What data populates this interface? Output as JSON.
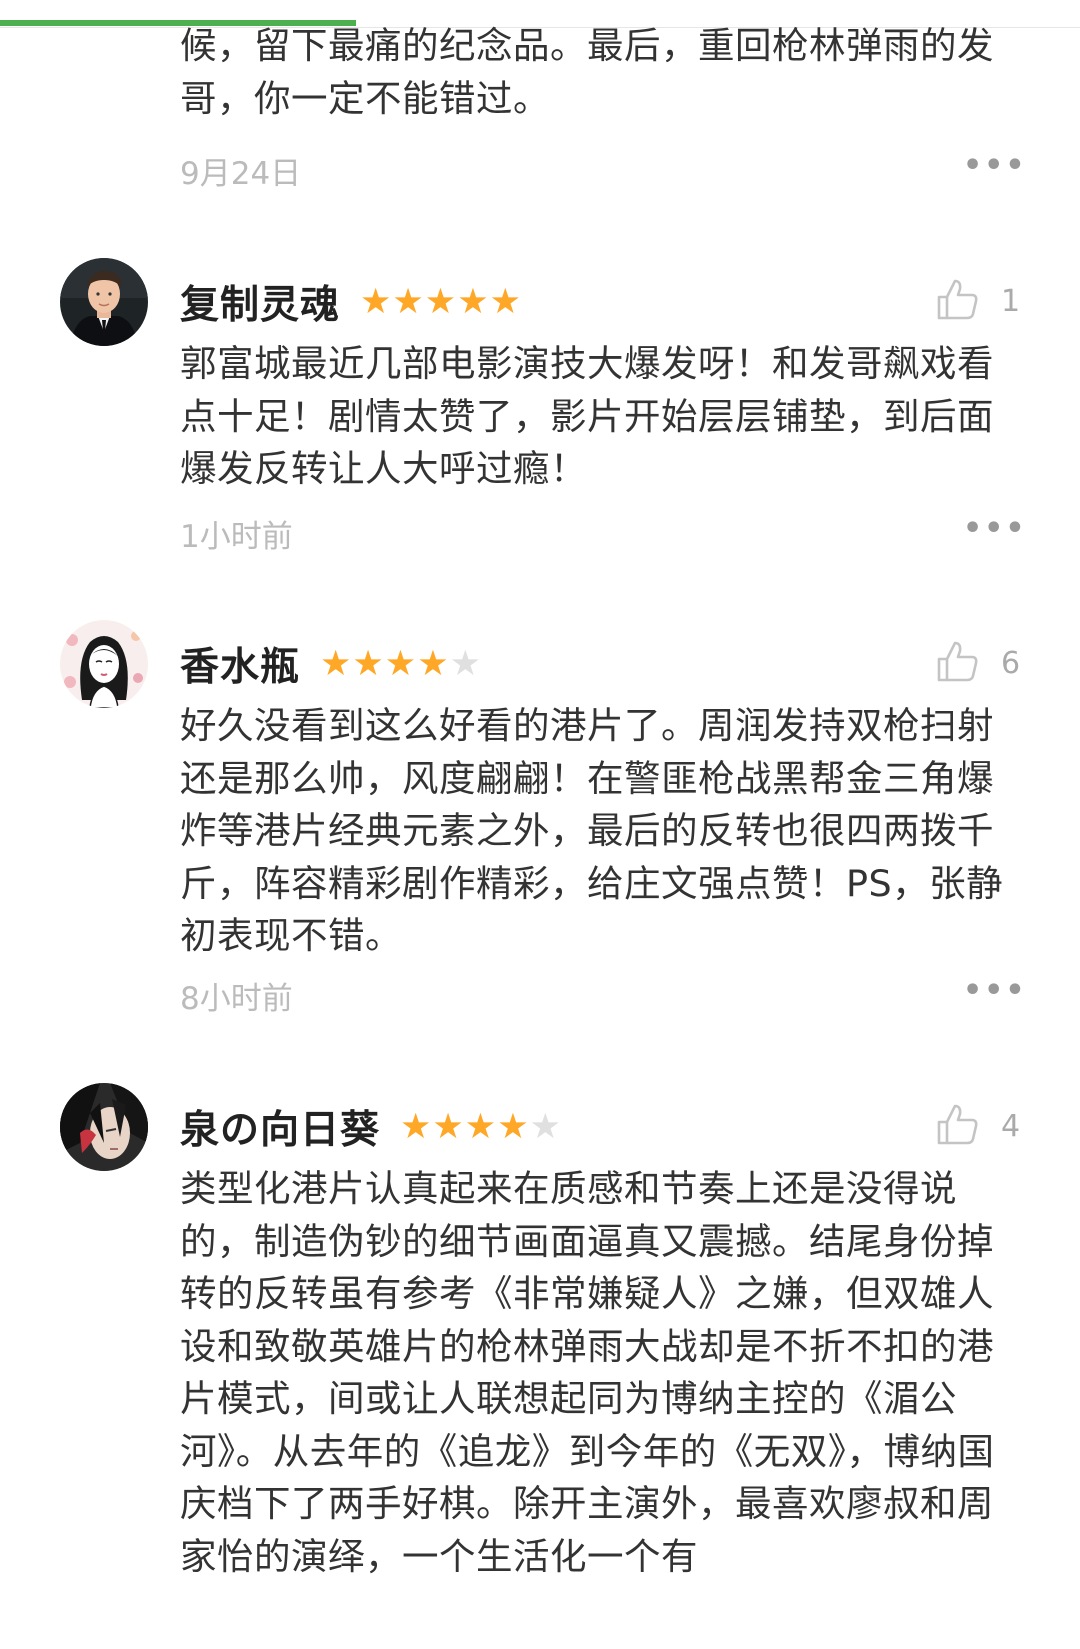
{
  "progress": {
    "fraction": 0.33,
    "color": "#4caf50"
  },
  "top_partial": {
    "text": "候，留下最痛的纪念品。最后，重回枪林弹雨的发哥，你一定不能错过。",
    "time": "9月24日"
  },
  "reviews": [
    {
      "username": "复制灵魂",
      "rating": 5,
      "max_rating": 5,
      "likes": "1",
      "text": "郭富城最近几部电影演技大爆发呀！和发哥飙戏看点十足！剧情太赞了，影片开始层层铺垫，到后面爆发反转让人大呼过瘾！",
      "time": "1小时前",
      "avatar_icon": "male-portrait-avatar"
    },
    {
      "username": "香水瓶",
      "rating": 4,
      "max_rating": 5,
      "likes": "6",
      "text": "好久没看到这么好看的港片了。周润发持双枪扫射还是那么帅，风度翩翩！在警匪枪战黑帮金三角爆炸等港片经典元素之外，最后的反转也很四两拨千斤，阵容精彩剧作精彩，给庄文强点赞！PS，张静初表现不错。",
      "time": "8小时前",
      "avatar_icon": "illustrated-girl-avatar"
    },
    {
      "username": "泉の向日葵",
      "rating": 4,
      "max_rating": 5,
      "likes": "4",
      "text": "类型化港片认真起来在质感和节奏上还是没得说的，制造伪钞的细节画面逼真又震撼。结尾身份掉转的反转虽有参考《非常嫌疑人》之嫌，但双雄人设和致敬英雄片的枪林弹雨大战却是不折不扣的港片模式，间或让人联想起同为博纳主控的《湄公河》。从去年的《追龙》到今年的《无双》，博纳国庆档下了两手好棋。除开主演外，最喜欢廖叔和周家怡的演绎，一个生活化一个有",
      "avatar_icon": "anime-character-avatar"
    }
  ],
  "icons": {
    "like": "thumbs-up-icon",
    "more": "more-options-icon",
    "star": "star-icon"
  },
  "colors": {
    "star_on": "#ffa726",
    "star_off": "#e0e0e0",
    "meta_text": "#bbbbbb"
  }
}
